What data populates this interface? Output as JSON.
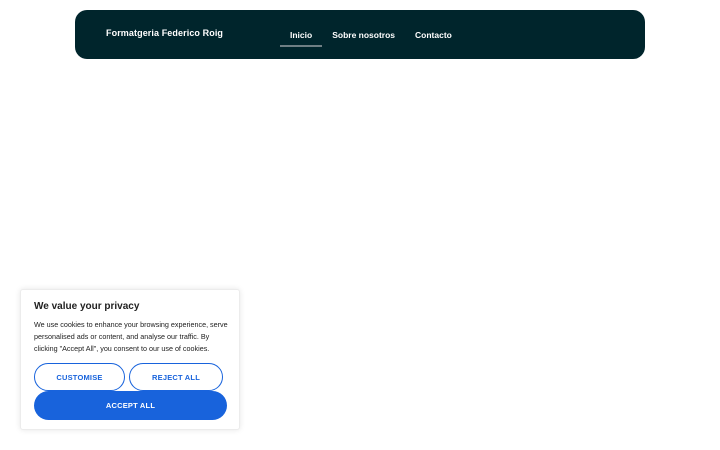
{
  "header": {
    "brand": "Formatgeria Federico Roig",
    "nav": [
      {
        "label": "Inicio",
        "active": true
      },
      {
        "label": "Sobre nosotros",
        "active": false
      },
      {
        "label": "Contacto",
        "active": false
      }
    ]
  },
  "cookie_banner": {
    "title": "We value your privacy",
    "text": "We use cookies to enhance your browsing experience, serve personalised ads or content, and analyse our traffic. By clicking \"Accept All\", you consent to our use of cookies.",
    "customise_label": "CUSTOMISE",
    "reject_label": "REJECT ALL",
    "accept_label": "ACCEPT ALL"
  },
  "colors": {
    "header_bg": "#00252c",
    "accent": "#1863dc"
  }
}
